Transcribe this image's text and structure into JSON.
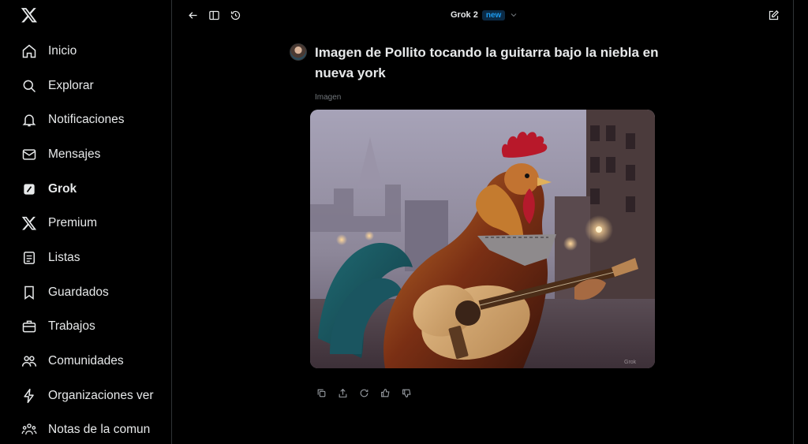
{
  "sidebar": {
    "logo": "x-logo-icon",
    "items": [
      {
        "label": "Inicio",
        "icon": "home-icon"
      },
      {
        "label": "Explorar",
        "icon": "search-icon"
      },
      {
        "label": "Notificaciones",
        "icon": "bell-icon"
      },
      {
        "label": "Mensajes",
        "icon": "mail-icon"
      },
      {
        "label": "Grok",
        "icon": "grok-icon",
        "active": true
      },
      {
        "label": "Premium",
        "icon": "x-premium-icon"
      },
      {
        "label": "Listas",
        "icon": "list-icon"
      },
      {
        "label": "Guardados",
        "icon": "bookmark-icon"
      },
      {
        "label": "Trabajos",
        "icon": "briefcase-icon"
      },
      {
        "label": "Comunidades",
        "icon": "communities-icon"
      },
      {
        "label": "Organizaciones ver",
        "icon": "lightning-icon"
      },
      {
        "label": "Notas de la comun",
        "icon": "community-notes-icon"
      }
    ]
  },
  "topbar": {
    "model_name": "Grok 2",
    "model_badge": "new",
    "icons": [
      "back-arrow-icon",
      "sidebar-toggle-icon",
      "history-icon",
      "new-chat-icon"
    ]
  },
  "conversation": {
    "prompt": "Imagen de Pollito tocando la guitarra bajo la niebla en nueva york",
    "image_label": "Imagen",
    "actions": [
      "copy-icon",
      "share-icon",
      "regenerate-icon",
      "thumbs-up-icon",
      "thumbs-down-icon"
    ]
  },
  "colors": {
    "background": "#000000",
    "text": "#e7e9ea",
    "muted": "#71767b",
    "accent": "#1d9bf0",
    "border": "#2f3336"
  }
}
